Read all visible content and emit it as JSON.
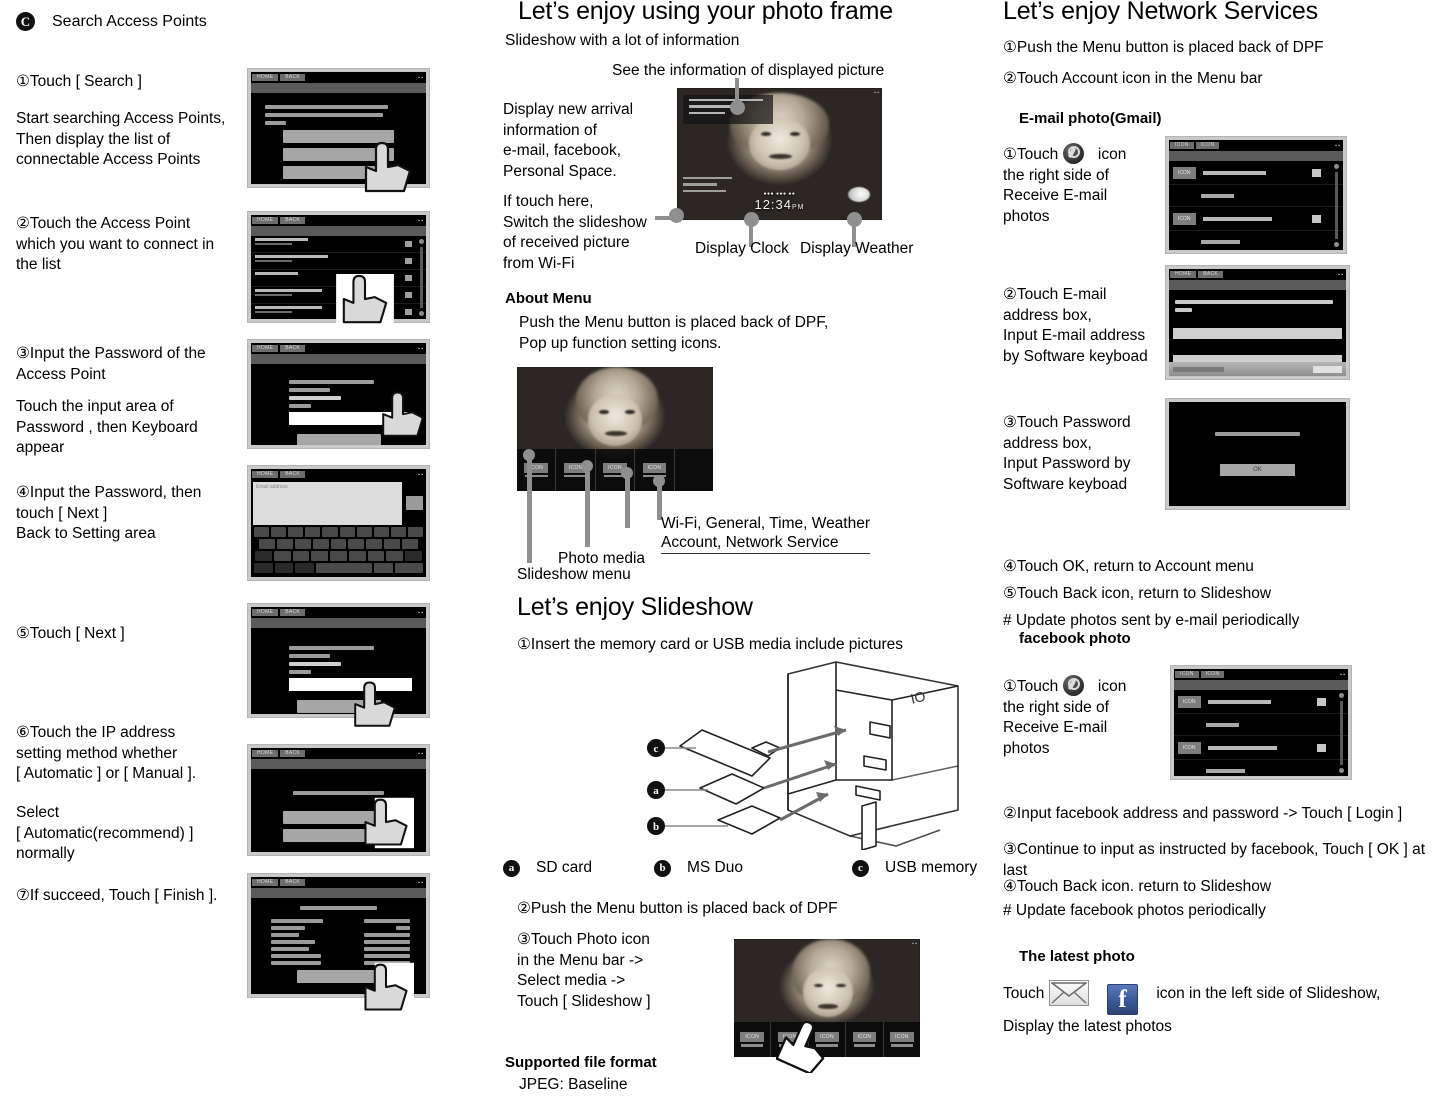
{
  "left": {
    "logo": "C",
    "header": "Search Access Points",
    "steps": [
      {
        "num": "①",
        "text": "Touch [ Search ]"
      },
      {
        "text": "Start searching Access Points,\nThen display the list of\nconnectable Access Points"
      },
      {
        "num": "②",
        "text": "Touch the Access Point\nwhich you want to connect in\nthe list"
      },
      {
        "num": "③",
        "text": "Input the Password of the\nAccess Point"
      },
      {
        "text": "Touch the input area of\nPassword , then Keyboard\nappear"
      },
      {
        "num": "④",
        "text": "Input the Password, then\ntouch [ Next ]\nBack to Setting area"
      },
      {
        "num": "⑤",
        "text": "Touch [ Next ]"
      },
      {
        "num": "⑥",
        "text": "Touch the IP address\nsetting method whether\n[ Automatic ] or [ Manual ]."
      },
      {
        "text": "Select\n[ Automatic(recommend) ]\nnormally"
      },
      {
        "num": "⑦",
        "text": "If succeed, Touch [ Finish ]."
      }
    ],
    "shots": {
      "home_label": "HOME",
      "back_label": "BACK",
      "keyboard_placeholder": "Email address"
    }
  },
  "mid": {
    "title": "Let’s enjoy using your photo frame",
    "subtitle": "Slideshow with a lot of information",
    "callout_top": "See the information of displayed picture",
    "left_note_1": "Display new arrival\ninformation of\ne-mail, facebook,\nPersonal Space.",
    "left_note_2": "If touch here,\nSwitch the slideshow\nof received picture\nfrom Wi-Fi",
    "label_clock": "Display Clock",
    "label_weather": "Display Weather",
    "clock_value": "12:34",
    "clock_ampm": "PM",
    "about_menu_heading": "About Menu",
    "about_menu_text": "Push the Menu button is placed back of DPF,\nPop up function setting icons.",
    "menu_icon_label": "ICON",
    "menu_callouts": {
      "right": "Wi-Fi, General, Time, Weather\nAccount, Network Service",
      "photo_media": "Photo media",
      "slideshow_menu": "Slideshow menu"
    },
    "slideshow_title": "Let’s enjoy Slideshow",
    "slideshow_steps": [
      {
        "num": "①",
        "text": "Insert the memory card or USB media include pictures"
      },
      {
        "num": "②",
        "text": "Push the Menu button is placed back of DPF"
      },
      {
        "num": "③",
        "text": "Touch Photo icon\nin the Menu bar ->\nSelect media ->\nTouch [ Slideshow ]"
      }
    ],
    "media_legend": [
      {
        "badge": "a",
        "label": "SD card"
      },
      {
        "badge": "b",
        "label": "MS Duo"
      },
      {
        "badge": "c",
        "label": "USB memory"
      }
    ],
    "diagram_badges": [
      "c",
      "a",
      "b"
    ],
    "diagram_port_label": "IO",
    "format_heading": "Supported file format",
    "format_value": "JPEG: Baseline"
  },
  "right": {
    "title": "Let’s enjoy Network Services",
    "intro_steps": [
      {
        "num": "①",
        "text": "Push the Menu button is placed back of DPF"
      },
      {
        "num": "②",
        "text": "Touch Account icon in the Menu bar"
      }
    ],
    "email_section": {
      "heading": "E-mail photo(Gmail)",
      "step1_pre": "Touch",
      "step1_post": "icon",
      "step1_rest": "the right side of\nReceive E-mail\nphotos",
      "step1_num": "①",
      "steps": [
        {
          "num": "②",
          "text": "Touch E-mail\naddress box,\nInput E-mail address\nby Software keyboad"
        },
        {
          "num": "③",
          "text": "Touch Password\naddress box,\nInput Password by\nSoftware keyboad"
        },
        {
          "num": "④",
          "text": "Touch OK, return to Account menu"
        },
        {
          "num": "⑤",
          "text": "Touch Back icon, return to Slideshow"
        },
        {
          "num": "#",
          "text": " Update photos sent by e-mail periodically"
        }
      ],
      "ok_label": "OK"
    },
    "facebook_section": {
      "heading": "facebook photo",
      "step1_num": "①",
      "step1_pre": "Touch",
      "step1_post": "icon",
      "step1_rest": "the right side of\nReceive E-mail\nphotos",
      "steps": [
        {
          "num": "②",
          "text": "Input facebook address and password -> Touch [ Login ]"
        },
        {
          "num": "③",
          "text": "Continue to input as instructed by facebook, Touch [ OK ] at last"
        },
        {
          "num": "④",
          "text": "Touch Back icon. return to Slideshow"
        },
        {
          "num": "#",
          "text": " Update facebook photos periodically"
        }
      ]
    },
    "latest_section": {
      "heading": "The latest photo",
      "pre": "Touch",
      "post": "icon in the left side of Slideshow,",
      "second_line": "Display the latest photos",
      "fb_glyph": "f"
    },
    "shots": {
      "icon_label": "ICON",
      "home_label": "HOME",
      "back_label": "BACK"
    }
  },
  "colors": {
    "facebook_blue": "#3b5998",
    "screen_bezel": "#c9c9c9",
    "screen_black": "#000000",
    "button_gray": "#a6a6a6",
    "lead_gray": "#8f8f8f"
  }
}
